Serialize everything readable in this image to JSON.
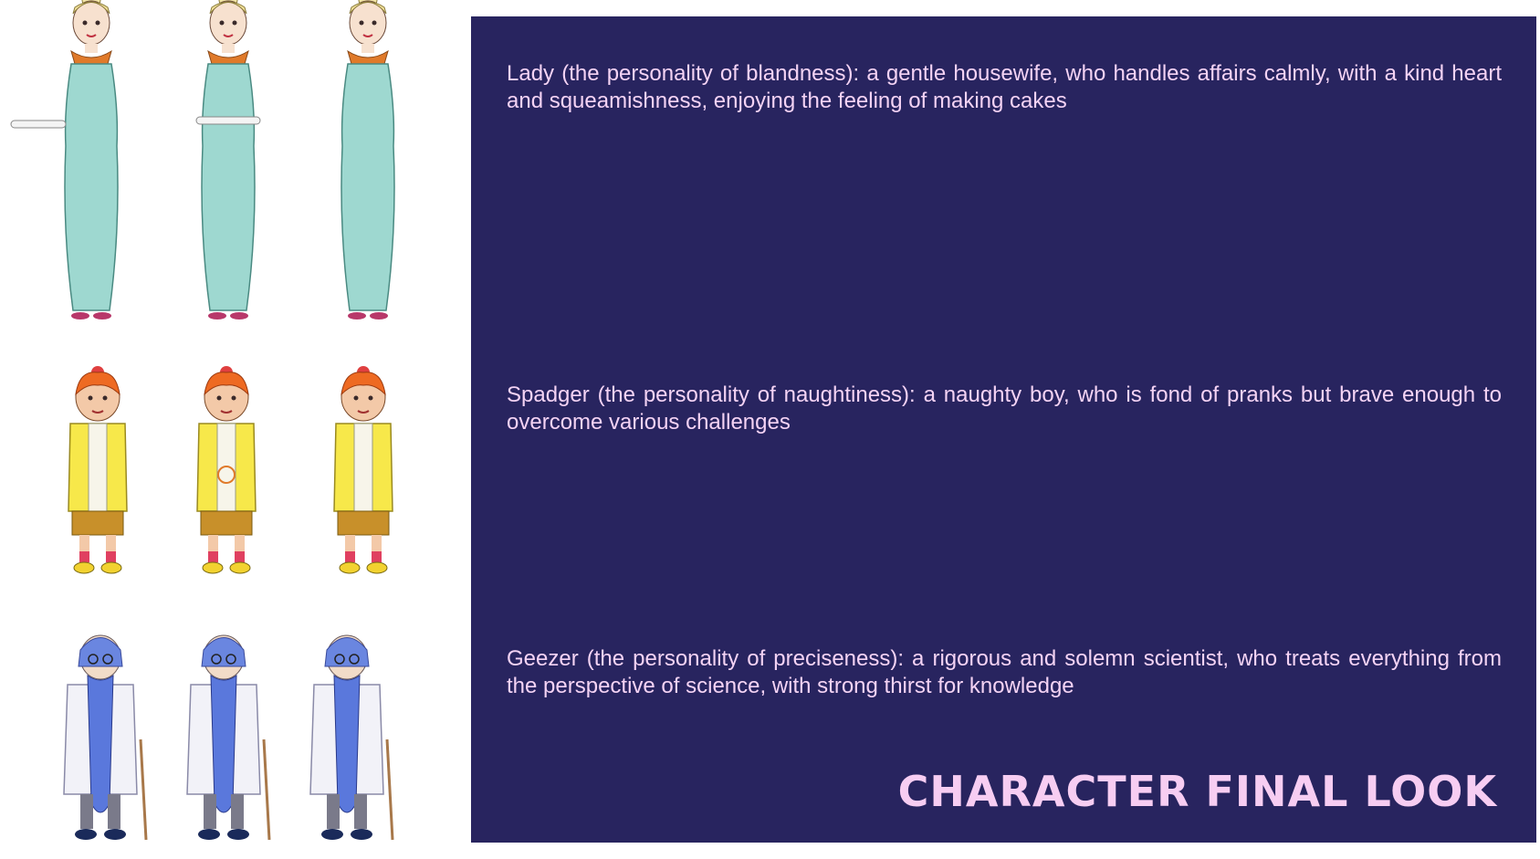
{
  "slide": {
    "title": "Character Final Look",
    "colors": {
      "panel_background": "#28245f",
      "panel_text": "#f4d3f4",
      "page_background": "#ffffff"
    }
  },
  "characters": [
    {
      "name": "Lady",
      "description": "Lady (the personality of blandness): a gentle housewife, who handles affairs calmly, with a kind heart and squeamishness, enjoying the feeling of making cakes",
      "views": [
        "front-three-quarter",
        "front",
        "back"
      ]
    },
    {
      "name": "Spadger",
      "description": "Spadger (the personality of naughtiness): a naughty boy, who is fond of pranks but brave enough to overcome various challenges",
      "views": [
        "front",
        "back",
        "side"
      ]
    },
    {
      "name": "Geezer",
      "description": "Geezer (the personality of preciseness): a rigorous and solemn scientist, who treats everything from the perspective of science, with strong thirst for knowledge",
      "views": [
        "front",
        "back",
        "side"
      ]
    }
  ]
}
